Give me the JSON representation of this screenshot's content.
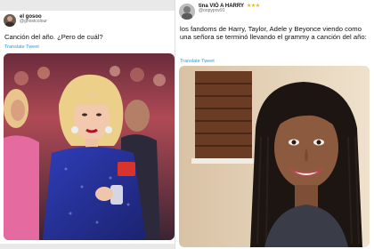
{
  "left_tweet": {
    "display_name": "el gosoo",
    "handle": "@ghostcolour",
    "text": "Canción del año. ¿Pero de cuál?",
    "translate_label": "Translate Tweet",
    "media_description_icon": "photo-concert-crowd"
  },
  "right_tweet": {
    "display_name": "tina VIÓ A HARRY",
    "stars": "★★★",
    "handle": "@oopypov91",
    "text": "los fandoms de Harry, Taylor, Adele y Beyonce viendo como una señora se terminó llevando el grammy a canción del año:",
    "translate_label": "Translate Tweet",
    "media_description_icon": "photo-smiling-woman"
  },
  "colors": {
    "link_blue": "#1d9bf0",
    "star_gold": "#f4b400"
  }
}
